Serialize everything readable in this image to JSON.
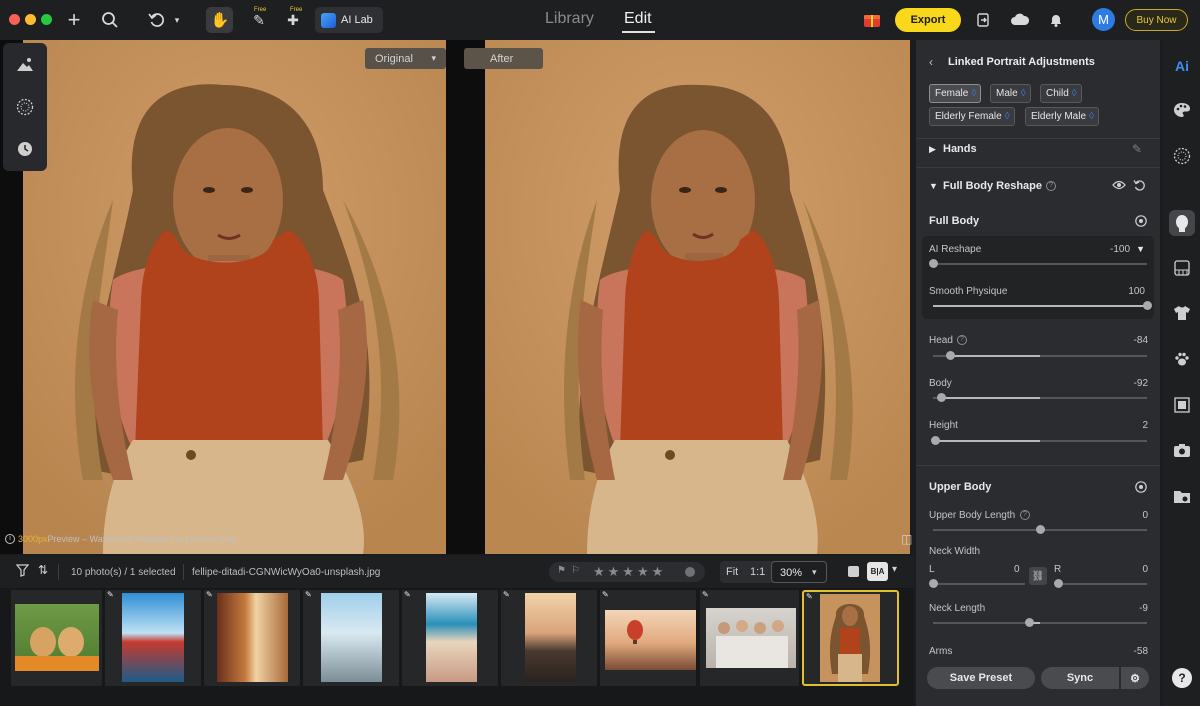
{
  "topbar": {
    "free_badge_1": "Free",
    "free_badge_2": "Free",
    "ai_lab_label": "AI Lab",
    "library_tab": "Library",
    "edit_tab": "Edit",
    "export_label": "Export",
    "avatar_initial": "M",
    "buy_now_label": "Buy Now"
  },
  "canvas": {
    "original_label": "Original",
    "after_label": "After",
    "preview_px": "3000px",
    "preview_note": " Preview – Watermark displayed in preview only."
  },
  "panel": {
    "title": "Linked Portrait Adjustments",
    "chips": [
      "Female",
      "Male",
      "Child",
      "Elderly Female",
      "Elderly Male"
    ],
    "hands_label": "Hands",
    "reshape_section": "Full Body Reshape",
    "full_body_label": "Full Body",
    "sliders_ai": [
      {
        "label": "AI Reshape",
        "value": "-100",
        "level": 0.0
      },
      {
        "label": "Smooth Physique",
        "value": "100",
        "level": 1.0
      }
    ],
    "sliders_full": [
      {
        "label": "Head",
        "value": "-84",
        "level": 0.08
      },
      {
        "label": "Body",
        "value": "-92",
        "level": 0.04
      },
      {
        "label": "Height",
        "value": "2",
        "level": 0.01
      }
    ],
    "upper_body_label": "Upper Body",
    "upper_body_length": {
      "label": "Upper Body Length",
      "value": "0",
      "level": 0.5
    },
    "neck_width": {
      "label": "Neck Width",
      "l_label": "L",
      "l_value": "0",
      "r_label": "R",
      "r_value": "0"
    },
    "neck_length": {
      "label": "Neck Length",
      "value": "-9",
      "level": 0.45
    },
    "arms": {
      "label": "Arms",
      "value": "-58"
    },
    "save_preset_label": "Save Preset",
    "sync_label": "Sync"
  },
  "filmstrip": {
    "count_text": "10 photo(s) / 1 selected",
    "filename": "fellipe-ditadi-CGNWicWyOa0-unsplash.jpg",
    "fit_label": "Fit",
    "one_to_one_label": "1:1",
    "zoom_value": "30%",
    "ba_label": "B|A"
  },
  "rail": {
    "ai_label": "Ai",
    "help_label": "?"
  },
  "colors": {
    "export_bg": "#f8d81b",
    "accent_blue": "#2e7be5",
    "selected_frame": "#e0c02d"
  }
}
